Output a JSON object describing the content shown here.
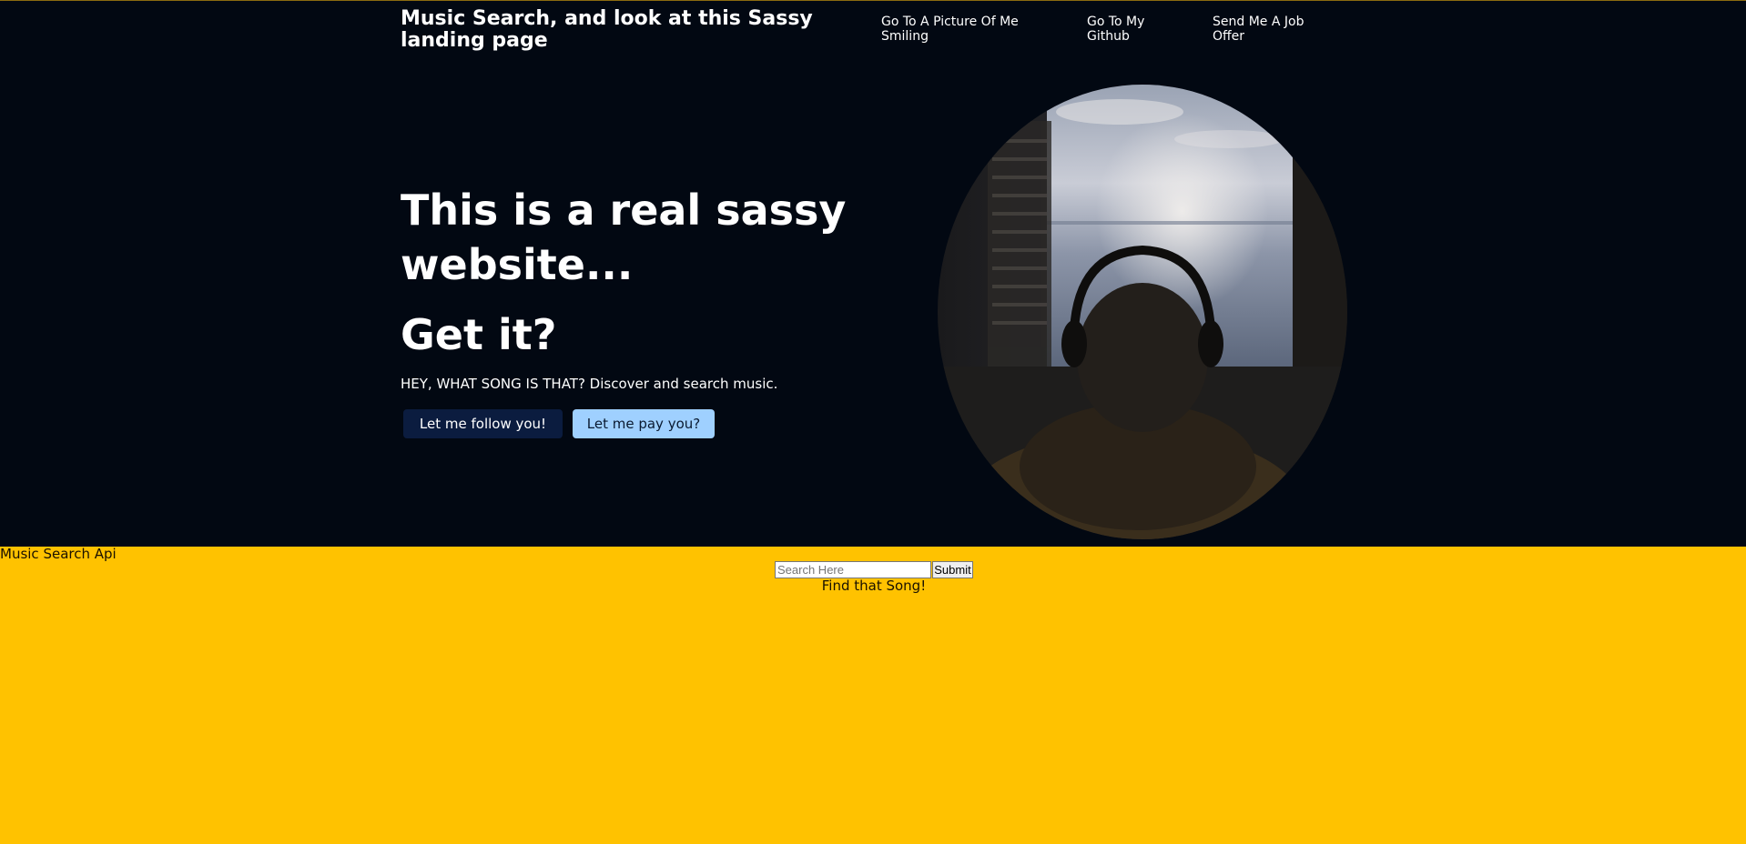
{
  "header": {
    "title": "Music Search, and look at this Sassy landing page",
    "nav": [
      {
        "label": "Go To A Picture Of Me Smiling"
      },
      {
        "label": "Go To My Github"
      },
      {
        "label": "Send Me A Job Offer"
      }
    ]
  },
  "hero": {
    "headline": "This is a real sassy website...",
    "subheadline": "Get it?",
    "tagline": "HEY, WHAT SONG IS THAT? Discover and search music.",
    "buttons": {
      "follow": "Let me follow you!",
      "pay": "Let me pay you?"
    },
    "image": {
      "icon": "person-with-headphones-photo"
    }
  },
  "search": {
    "section_label": "Music Search Api",
    "placeholder": "Search Here",
    "value": "",
    "submit_label": "Submit",
    "caption": "Find that Song!"
  },
  "colors": {
    "hero_bg": "#020812",
    "page_bg": "#ffc200",
    "follow_button": "#0b1c3f",
    "pay_button": "#9fd0ff"
  }
}
